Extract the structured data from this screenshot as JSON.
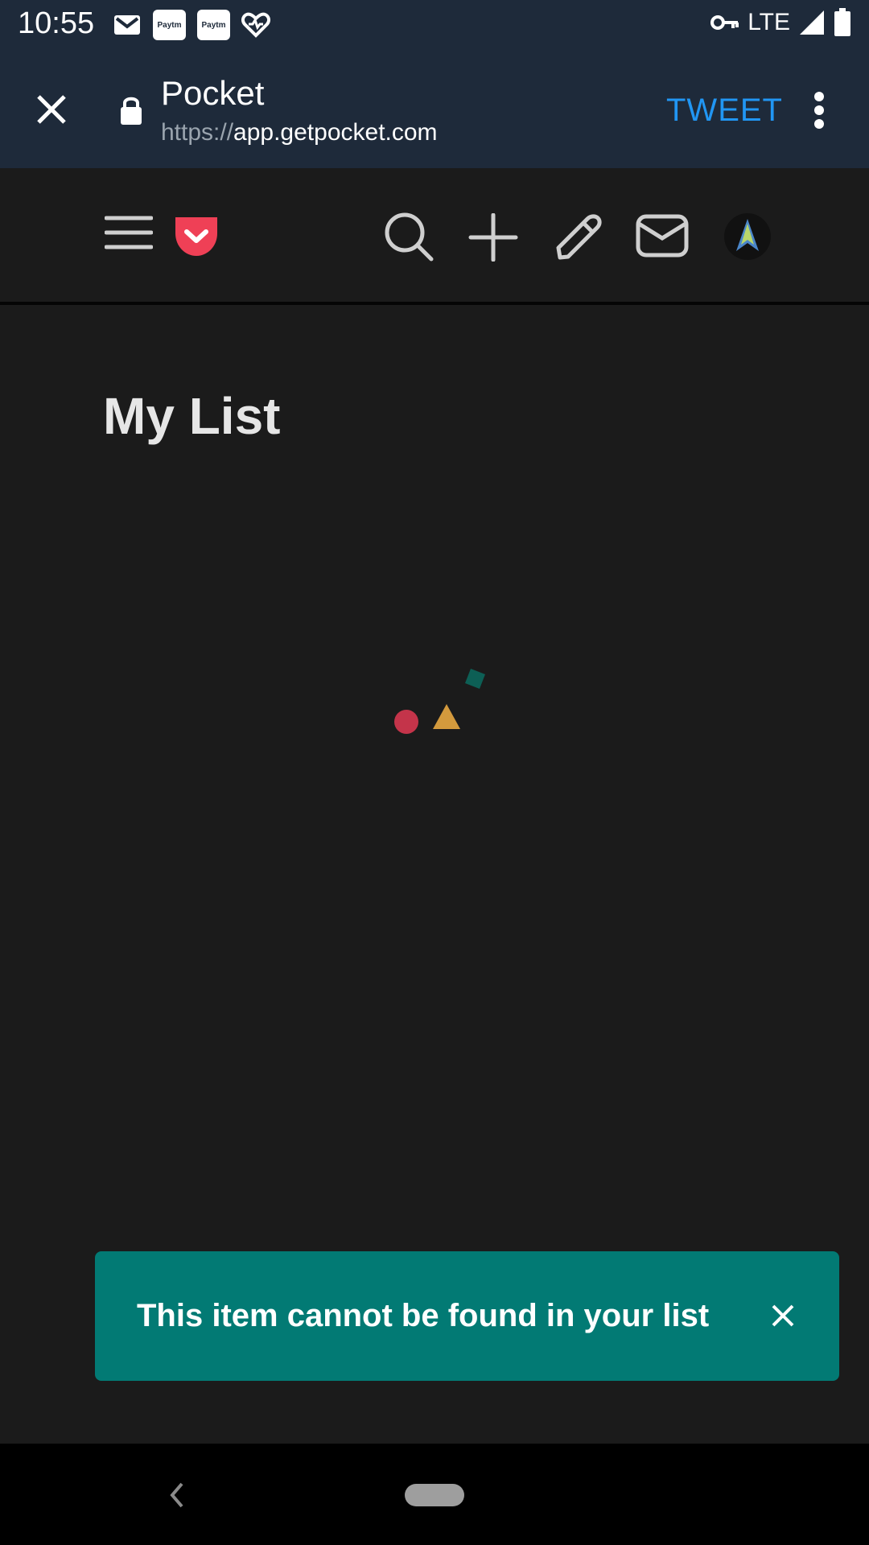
{
  "status_bar": {
    "time": "10:55",
    "paytm_label": "Paytm",
    "network": "LTE",
    "icons": [
      "gmail-icon",
      "paytm-icon",
      "paytm-icon",
      "heart-health-icon",
      "vpn-key-icon",
      "signal-icon",
      "battery-icon"
    ]
  },
  "browser_toolbar": {
    "title": "Pocket",
    "url_scheme": "https://",
    "url_host": "app.getpocket.com",
    "action_label": "TWEET",
    "accent_color": "#2196f3"
  },
  "app_header": {
    "icons": [
      "menu-icon",
      "pocket-logo-icon",
      "search-icon",
      "add-icon",
      "edit-icon",
      "inbox-icon",
      "avatar-icon"
    ],
    "brand_color": "#ef4056"
  },
  "main": {
    "title": "My List"
  },
  "toast": {
    "message": "This item cannot be found in your list",
    "background": "#027a74"
  },
  "nav_bar": {
    "icons": [
      "back-icon",
      "home-pill"
    ]
  }
}
